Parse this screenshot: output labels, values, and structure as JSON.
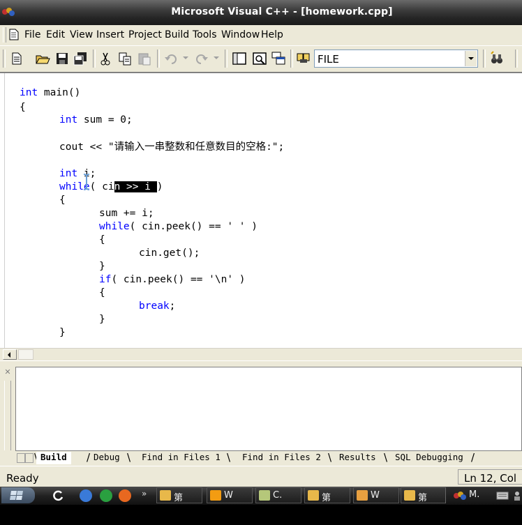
{
  "window": {
    "title": "Microsoft Visual C++ - [homework.cpp]"
  },
  "menu": {
    "items": [
      "File",
      "Edit",
      "View",
      "Insert",
      "Project",
      "Build",
      "Tools",
      "Window",
      "Help"
    ]
  },
  "toolbar": {
    "find_value": "FILE"
  },
  "code": {
    "lines": [
      {
        "id": "l1",
        "indent": 0,
        "parts": [
          [
            "kw",
            "int"
          ],
          [
            "t",
            " main()"
          ]
        ]
      },
      {
        "id": "l2",
        "indent": 0,
        "parts": [
          [
            "t",
            "{"
          ]
        ]
      },
      {
        "id": "l3",
        "indent": 1,
        "parts": [
          [
            "kw",
            "int"
          ],
          [
            "t",
            " sum = 0;"
          ]
        ]
      },
      {
        "id": "l4",
        "indent": 1,
        "parts": [
          [
            "t",
            "cout << \"请输入一串整数和任意数目的空格:\";"
          ]
        ]
      },
      {
        "id": "l5",
        "indent": 1,
        "parts": [
          [
            "kw",
            "int"
          ],
          [
            "t",
            " i;"
          ]
        ]
      },
      {
        "id": "l6",
        "indent": 1,
        "parts": [
          [
            "kw",
            "while"
          ],
          [
            "t",
            "( ci"
          ],
          [
            "sel",
            "n >> i "
          ],
          [
            "t",
            ")"
          ]
        ]
      },
      {
        "id": "l7",
        "indent": 1,
        "parts": [
          [
            "t",
            "{"
          ]
        ]
      },
      {
        "id": "l8",
        "indent": 2,
        "parts": [
          [
            "t",
            "sum += i;"
          ]
        ]
      },
      {
        "id": "l9",
        "indent": 2,
        "parts": [
          [
            "kw",
            "while"
          ],
          [
            "t",
            "( cin.peek() == ' ' )"
          ]
        ]
      },
      {
        "id": "l10",
        "indent": 2,
        "parts": [
          [
            "t",
            "{"
          ]
        ]
      },
      {
        "id": "l11",
        "indent": 3,
        "parts": [
          [
            "t",
            "cin.get();"
          ]
        ]
      },
      {
        "id": "l12",
        "indent": 2,
        "parts": [
          [
            "t",
            "}"
          ]
        ]
      },
      {
        "id": "l13",
        "indent": 2,
        "parts": [
          [
            "kw",
            "if"
          ],
          [
            "t",
            "( cin.peek() == '\\n' )"
          ]
        ]
      },
      {
        "id": "l14",
        "indent": 2,
        "parts": [
          [
            "t",
            "{"
          ]
        ]
      },
      {
        "id": "l15",
        "indent": 3,
        "parts": [
          [
            "kw",
            "break"
          ],
          [
            "t",
            ";"
          ]
        ]
      },
      {
        "id": "l16",
        "indent": 2,
        "parts": [
          [
            "t",
            "}"
          ]
        ]
      },
      {
        "id": "l17",
        "indent": 1,
        "parts": [
          [
            "t",
            "}"
          ]
        ]
      }
    ]
  },
  "output": {
    "tabs": [
      "Build",
      "Debug",
      "Find in Files 1",
      "Find in Files 2",
      "Results",
      "SQL Debugging"
    ],
    "active_tab": "Build"
  },
  "status": {
    "text": "Ready",
    "position": "Ln 12, Col"
  },
  "taskbar": {
    "buttons": [
      {
        "label": "第",
        "color": "#e8b84a"
      },
      {
        "label": "W",
        "color": "#f39c12"
      },
      {
        "label": "C.",
        "color": "#b5c77a"
      },
      {
        "label": "第",
        "color": "#e8b84a"
      },
      {
        "label": "W",
        "color": "#e8a040"
      },
      {
        "label": "第",
        "color": "#e8b84a"
      }
    ],
    "tray_label": "M."
  },
  "colors": {
    "keyword": "#0000ff",
    "chrome": "#ece9d8"
  }
}
